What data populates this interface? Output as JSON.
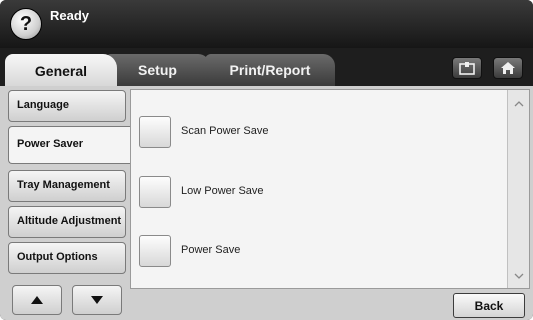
{
  "header": {
    "help_symbol": "?",
    "status": "Ready"
  },
  "tabs": [
    {
      "label": "General",
      "active": true
    },
    {
      "label": "Setup",
      "active": false
    },
    {
      "label": "Print/Report",
      "active": false
    }
  ],
  "top_icons": [
    "card-icon",
    "home-icon"
  ],
  "menu": [
    {
      "label": "Language",
      "selected": false
    },
    {
      "label": "Power Saver",
      "selected": true
    },
    {
      "label": "Tray Management",
      "selected": false
    },
    {
      "label": "Altitude Adjustment",
      "selected": false
    },
    {
      "label": "Output Options",
      "selected": false
    }
  ],
  "options": [
    {
      "label": "Scan Power Save"
    },
    {
      "label": "Low Power Save"
    },
    {
      "label": "Power Save"
    }
  ],
  "footer": {
    "back_label": "Back"
  },
  "colors": {
    "header_bg": "#1c1c1c",
    "body_bg": "#cfcfcf",
    "panel_bg": "#f4f4f4"
  }
}
